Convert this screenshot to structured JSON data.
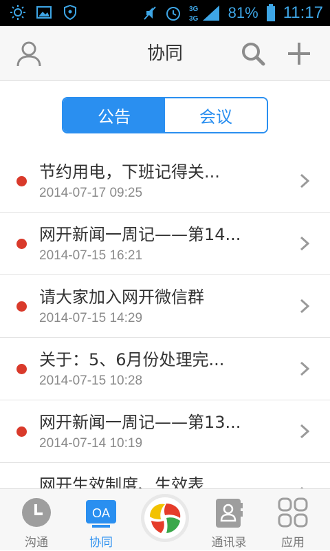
{
  "status_bar": {
    "battery_pct": "81%",
    "time": "11:17",
    "network": "3G",
    "icons": [
      "brightness-icon",
      "image-icon",
      "shield-icon",
      "mute-icon",
      "alarm-icon",
      "signal-icon",
      "battery-icon"
    ],
    "color": "#3ea6e6"
  },
  "header": {
    "title": "协同",
    "left_icon": "user-icon",
    "right_icons": [
      "search-icon",
      "plus-icon"
    ]
  },
  "segment": {
    "tabs": [
      {
        "label": "公告",
        "active": true
      },
      {
        "label": "会议",
        "active": false
      }
    ],
    "accent": "#2a8ff0"
  },
  "notices": [
    {
      "title": "节约用电，下班记得关...",
      "date": "2014-07-17 09:25",
      "unread": true
    },
    {
      "title": "网开新闻一周记——第14...",
      "date": "2014-07-15 16:21",
      "unread": true
    },
    {
      "title": "请大家加入网开微信群",
      "date": "2014-07-15 14:29",
      "unread": true
    },
    {
      "title": "关于：5、6月份处理完...",
      "date": "2014-07-15 10:28",
      "unread": true
    },
    {
      "title": "网开新闻一周记——第13...",
      "date": "2014-07-14 10:19",
      "unread": true
    },
    {
      "title": "网开生效制度、生效表...",
      "date": "",
      "unread": true
    }
  ],
  "tabbar": {
    "items": [
      {
        "label": "沟通",
        "icon": "clock-icon",
        "active": false
      },
      {
        "label": "协同",
        "icon": "oa-icon",
        "icon_text": "OA",
        "active": true
      },
      {
        "label": "",
        "icon": "app-logo-icon",
        "active": false
      },
      {
        "label": "通讯录",
        "icon": "contacts-icon",
        "active": false
      },
      {
        "label": "应用",
        "icon": "apps-grid-icon",
        "active": false
      }
    ]
  }
}
